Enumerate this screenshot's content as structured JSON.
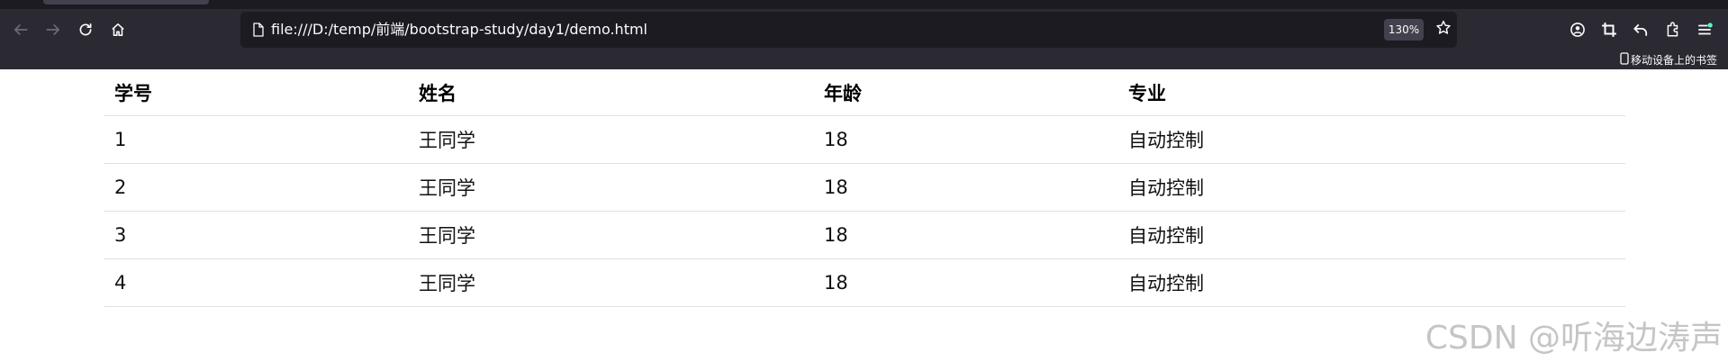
{
  "browser": {
    "url": "file:///D:/temp/前端/bootstrap-study/day1/demo.html",
    "zoom": "130%",
    "mobile_bookmarks_label": "移动设备上的书签",
    "icons": [
      "back-icon",
      "forward-icon",
      "reload-icon",
      "home-icon",
      "page-icon",
      "bookmark-star-icon",
      "account-icon",
      "crop-icon",
      "undo-icon",
      "extensions-icon",
      "menu-icon",
      "mobile-device-icon"
    ]
  },
  "table": {
    "headers": [
      "学号",
      "姓名",
      "年龄",
      "专业"
    ],
    "rows": [
      [
        "1",
        "王同学",
        "18",
        "自动控制"
      ],
      [
        "2",
        "王同学",
        "18",
        "自动控制"
      ],
      [
        "3",
        "王同学",
        "18",
        "自动控制"
      ],
      [
        "4",
        "王同学",
        "18",
        "自动控制"
      ]
    ]
  },
  "watermark": "CSDN @听海边涛声"
}
